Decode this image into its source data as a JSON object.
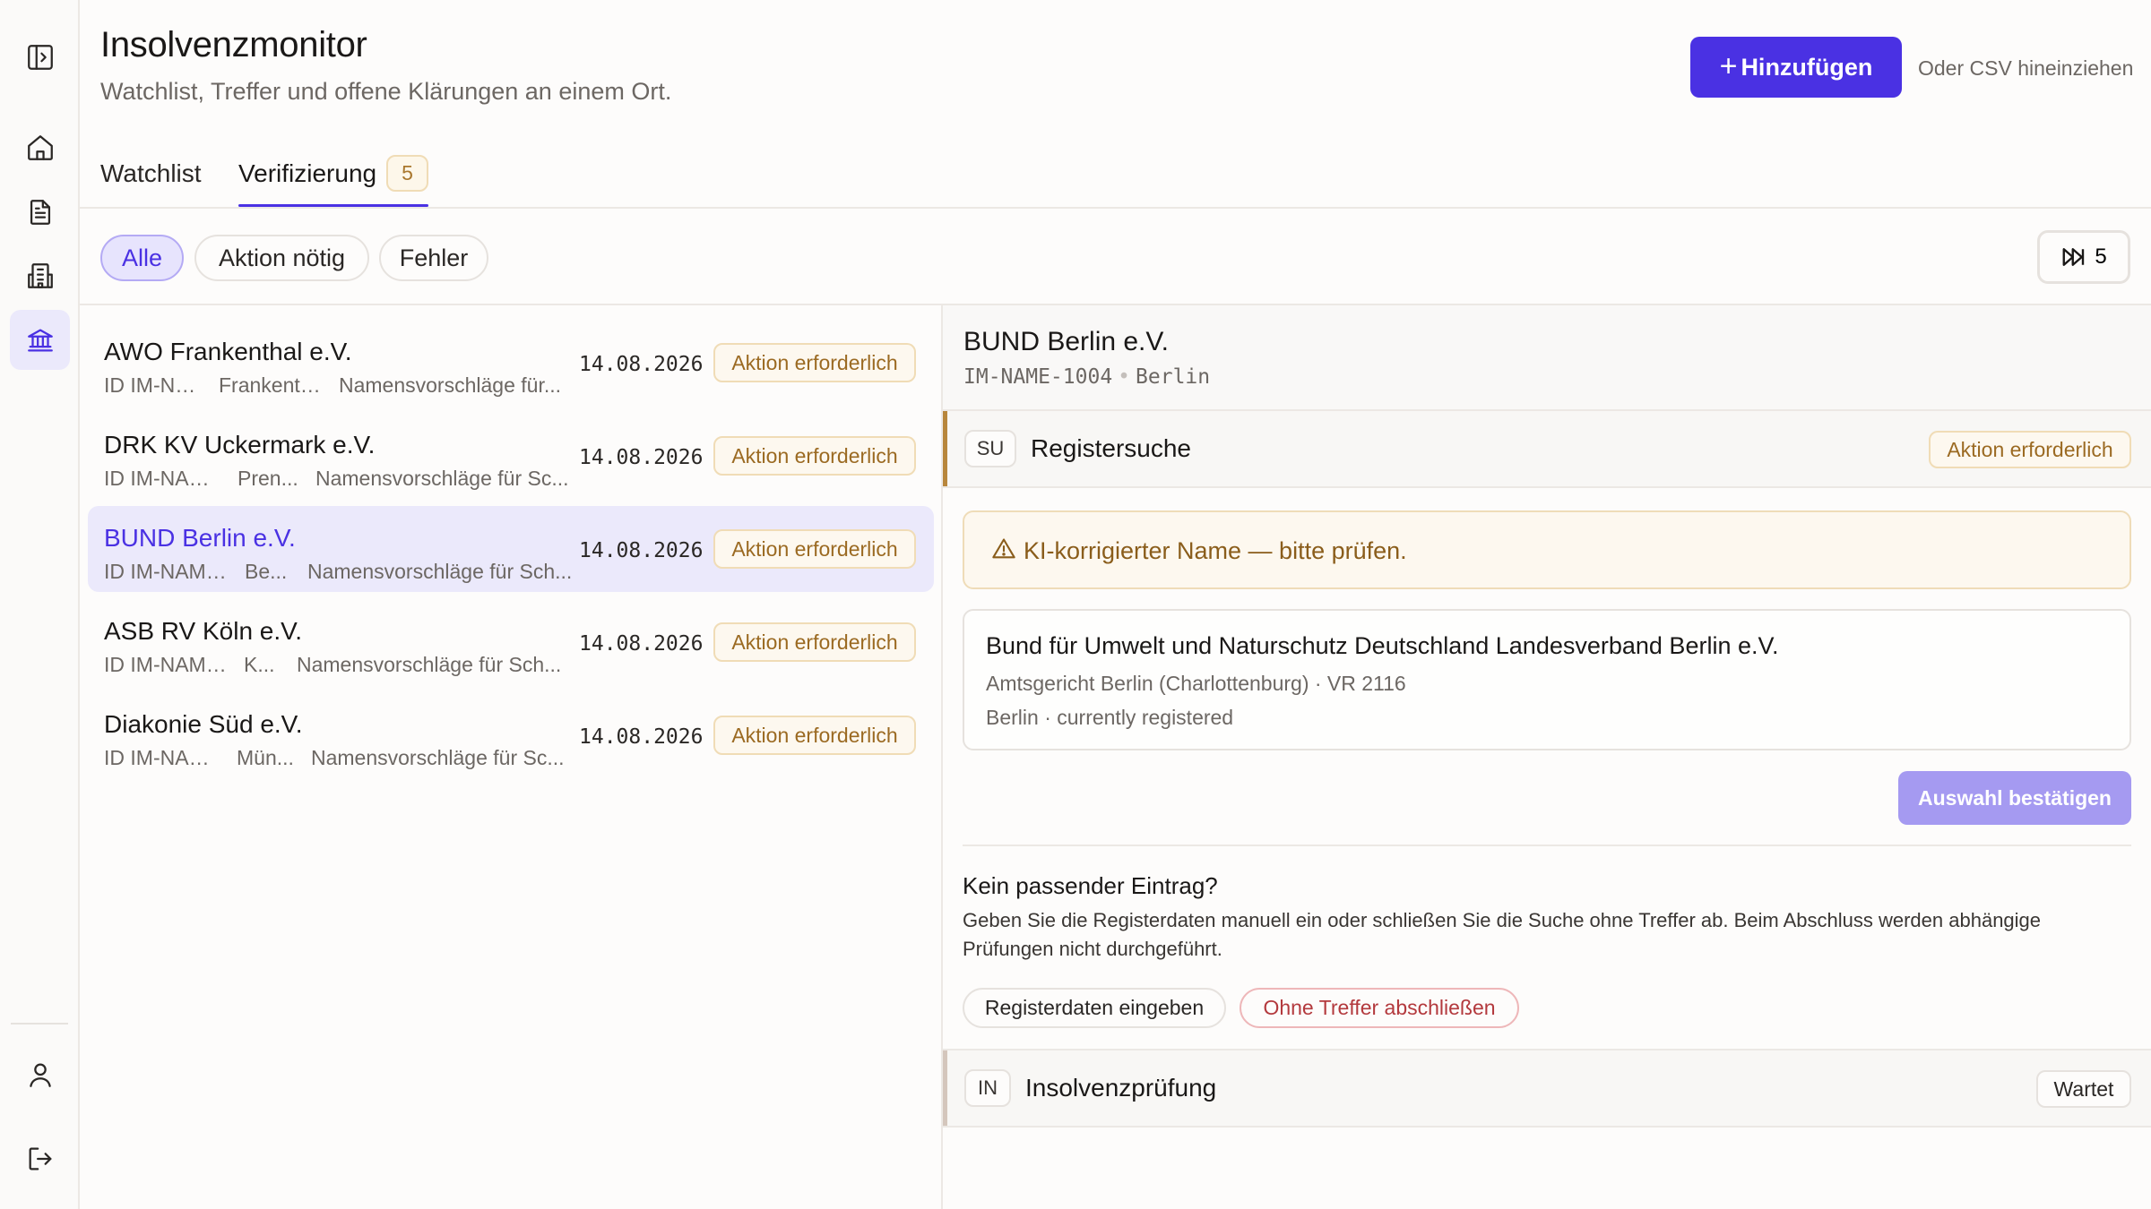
{
  "header": {
    "title": "Insolvenzmonitor",
    "subtitle": "Watchlist, Treffer und offene Klärungen an einem Ort.",
    "add_label": "Hinzufügen",
    "csv_hint": "Oder CSV hineinziehen"
  },
  "rail_icons": [
    "sidebar-toggle-icon",
    "home-icon",
    "document-icon",
    "building-icon",
    "bank-icon",
    "user-icon",
    "logout-icon"
  ],
  "tabs": [
    {
      "label": "Watchlist"
    },
    {
      "label": "Verifizierung",
      "count": "5"
    }
  ],
  "filters": [
    {
      "label": "Alle",
      "active": true
    },
    {
      "label": "Aktion nötig"
    },
    {
      "label": "Fehler"
    }
  ],
  "skip_count": "5",
  "rows": [
    {
      "name": "AWO Frankenthal e.V.",
      "id": "ID IM-NA...",
      "city": "Frankenth...",
      "note": "Namensvorschläge für...",
      "date": "14.08.2026",
      "status": "Aktion erforderlich"
    },
    {
      "name": "DRK KV Uckermark e.V.",
      "id": "ID IM-NAM...",
      "city": "Pren...",
      "note": "Namensvorschläge für Sc...",
      "date": "14.08.2026",
      "status": "Aktion erforderlich"
    },
    {
      "name": "BUND Berlin e.V.",
      "id": "ID IM-NAME...",
      "city": "Be...",
      "note": "Namensvorschläge für Sch...",
      "date": "14.08.2026",
      "status": "Aktion erforderlich",
      "selected": true
    },
    {
      "name": "ASB RV Köln e.V.",
      "id": "ID IM-NAME...",
      "city": "K...",
      "note": "Namensvorschläge für Sch...",
      "date": "14.08.2026",
      "status": "Aktion erforderlich"
    },
    {
      "name": "Diakonie Süd e.V.",
      "id": "ID IM-NAM...",
      "city": "Mün...",
      "note": "Namensvorschläge für Sc...",
      "date": "14.08.2026",
      "status": "Aktion erforderlich"
    }
  ],
  "detail": {
    "name": "BUND Berlin e.V.",
    "id": "IM-NAME-1004",
    "city": "Berlin",
    "step1": {
      "code": "SU",
      "title": "Registersuche",
      "status": "Aktion erforderlich"
    },
    "warning": "KI-korrigierter Name — bitte prüfen.",
    "candidate": {
      "name": "Bund für Umwelt und Naturschutz Deutschland Landesverband Berlin e.V.",
      "court": "Amtsgericht Berlin (Charlottenburg) · VR 2116",
      "location": "Berlin · currently registered"
    },
    "confirm_label": "Auswahl bestätigen",
    "nomatch_title": "Kein passender Eintrag?",
    "nomatch_text": "Geben Sie die Registerdaten manuell ein oder schließen Sie die Suche ohne Treffer ab. Beim Abschluss werden abhängige Prüfungen nicht durchgeführt.",
    "manual_label": "Registerdaten eingeben",
    "close_label": "Ohne Treffer abschließen",
    "step2": {
      "code": "IN",
      "title": "Insolvenzprüfung",
      "status": "Wartet"
    }
  },
  "colors": {
    "accent": "#4a31e3",
    "accent_soft": "#ebe9fb",
    "warning_text": "#9b6a22",
    "warning_border": "#f0dcb6",
    "danger_text": "#b3393d",
    "danger_border": "#eeb7b9"
  }
}
